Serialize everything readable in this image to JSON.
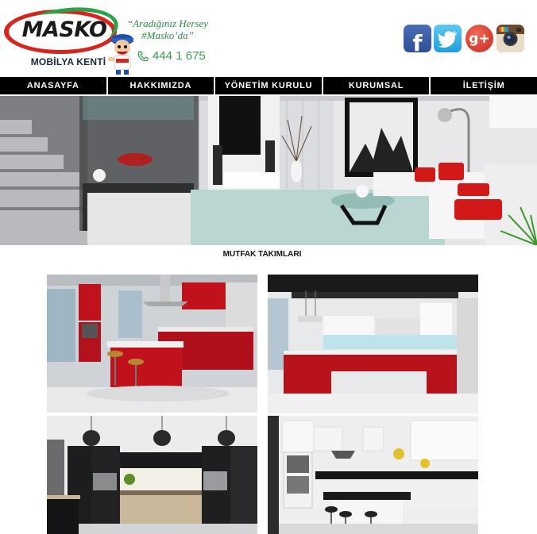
{
  "brand": {
    "name": "MASKO",
    "subtitle": "MOBİLYA KENTİ",
    "slogan_line1": "“Aradığınız Hersey",
    "slogan_line2": "#Masko’da”",
    "phone": "444 1 675"
  },
  "social": {
    "facebook": "f",
    "twitter": "t",
    "googleplus": "g+",
    "instagram": "camera"
  },
  "nav": {
    "items": [
      "ANASAYFA",
      "HAKKIMIZDA",
      "YÖNETİM KURULU",
      "KURUMSAL",
      "İLETİŞİM"
    ]
  },
  "section": {
    "title": "MUTFAK TAKIMLARI"
  },
  "gallery": {
    "images": [
      "red-island-kitchen",
      "red-u-shaped-kitchen",
      "black-wood-kitchen",
      "white-black-kitchen"
    ]
  },
  "colors": {
    "nav_bg": "#000000",
    "brand_red": "#d7251e",
    "brand_green": "#2e8c4a"
  }
}
